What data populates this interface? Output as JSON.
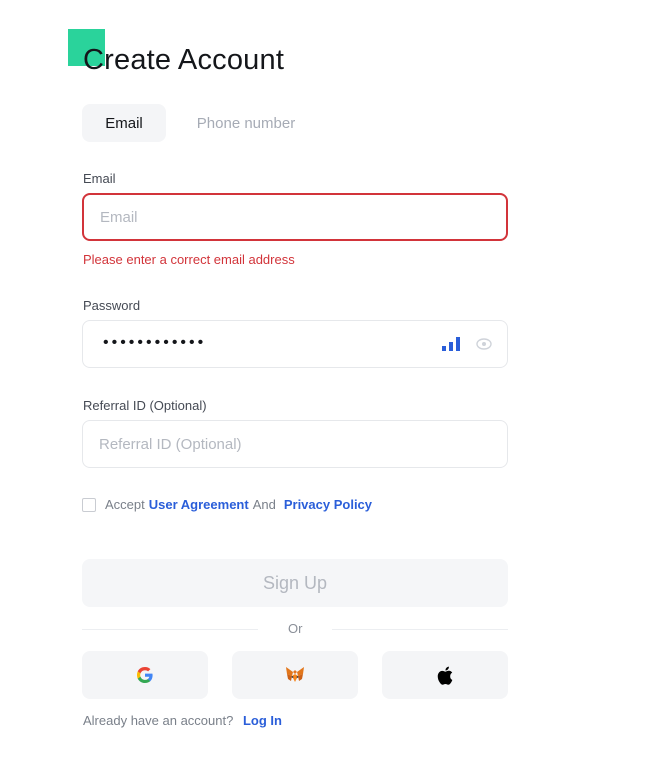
{
  "header": {
    "title": "Create Account"
  },
  "tabs": [
    {
      "label": "Email",
      "active": true
    },
    {
      "label": "Phone number",
      "active": false
    }
  ],
  "email": {
    "label": "Email",
    "placeholder": "Email",
    "value": "",
    "error": "Please enter a correct email address"
  },
  "password": {
    "label": "Password",
    "masked_value": "••••••••••••"
  },
  "referral": {
    "label": "Referral ID (Optional)",
    "placeholder": "Referral ID (Optional)"
  },
  "agreement": {
    "prefix": "Accept",
    "user_agreement": "User Agreement",
    "and": "And",
    "privacy_policy": "Privacy Policy"
  },
  "signup": {
    "label": "Sign Up"
  },
  "divider": {
    "text": "Or"
  },
  "social": [
    {
      "icon": "google-icon"
    },
    {
      "icon": "metamask-fox-icon"
    },
    {
      "icon": "apple-icon"
    }
  ],
  "footer": {
    "prompt": "Already have an account?",
    "login": "Log In"
  },
  "colors": {
    "accent": "#2ad39b",
    "error": "#d2343a",
    "link": "#2a5ed9",
    "strength": "#2a5ed9"
  }
}
